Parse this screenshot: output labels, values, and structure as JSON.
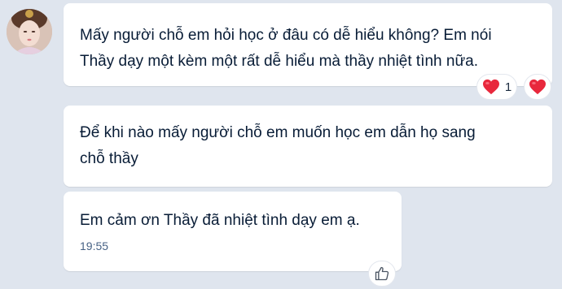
{
  "messages": [
    {
      "text_line1": "Mấy người chỗ em hỏi học ở đâu có dễ hiểu không? Em nói",
      "text_line2": "Thầy dạy một kèm một rất dễ hiểu mà thầy nhiệt tình nữa."
    },
    {
      "text_line1": "Để khi nào mấy người chỗ em muốn học em dẫn họ sang",
      "text_line2": "chỗ thầy"
    },
    {
      "text": "Em cảm ơn Thầy đã nhiệt tình dạy em ạ.",
      "time": "19:55"
    }
  ],
  "reaction": {
    "icon": "heart-icon",
    "count": "1"
  },
  "colors": {
    "background": "#dfe5ee",
    "heart": "#e8283c"
  }
}
